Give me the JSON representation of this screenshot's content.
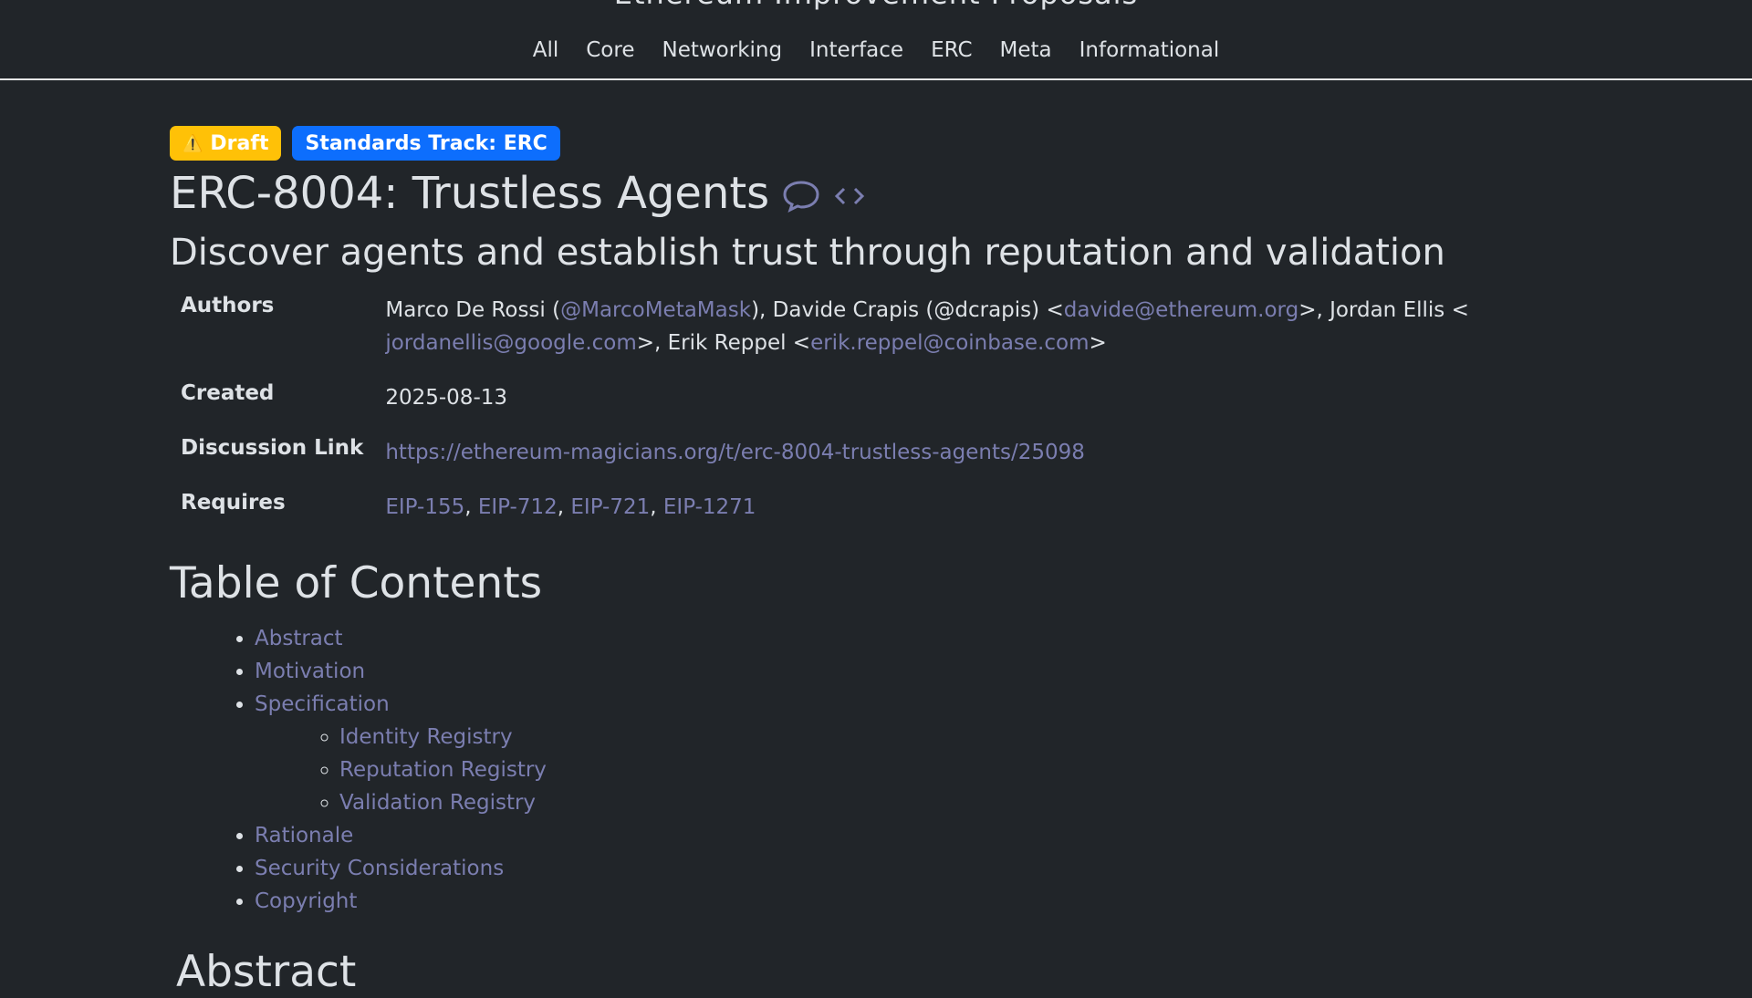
{
  "site": {
    "title": "Ethereum Improvement Proposals"
  },
  "nav": {
    "items": [
      {
        "label": "All"
      },
      {
        "label": "Core"
      },
      {
        "label": "Networking"
      },
      {
        "label": "Interface"
      },
      {
        "label": "ERC"
      },
      {
        "label": "Meta"
      },
      {
        "label": "Informational"
      }
    ]
  },
  "badges": {
    "draft_icon": "⚠️",
    "draft_label": "Draft",
    "track_label": "Standards Track: ERC",
    "draft_color": "#ffc107",
    "track_color": "#0d6efd"
  },
  "proposal": {
    "title": "ERC-8004: Trustless Agents",
    "subtitle": "Discover agents and establish trust through reputation and validation",
    "icons": [
      "comment-icon",
      "code-icon"
    ]
  },
  "meta": {
    "authors_label": "Authors",
    "authors": {
      "a1_text": "Marco De Rossi (",
      "a1_link": "@MarcoMetaMask",
      "a2_text": "), Davide Crapis (@dcrapis) <",
      "a2_link": "davide@ethereum.org",
      "a3_text": ">, Jordan Ellis <",
      "a3_link": "jordanellis@google.com",
      "a4_text": ">, Erik Reppel <",
      "a4_link": "erik.reppel@coinbase.com",
      "a4_end": ">"
    },
    "created_label": "Created",
    "created": "2025-08-13",
    "discussion_label": "Discussion Link",
    "discussion": "https://ethereum-magicians.org/t/erc-8004-trustless-agents/25098",
    "requires_label": "Requires",
    "requires": [
      "EIP-155",
      "EIP-712",
      "EIP-721",
      "EIP-1271"
    ]
  },
  "toc": {
    "heading": "Table of Contents",
    "items": [
      "Abstract",
      "Motivation",
      "Specification"
    ],
    "sub_items": [
      "Identity Registry",
      "Reputation Registry",
      "Validation Registry"
    ],
    "items_after": [
      "Rationale",
      "Security Considerations",
      "Copyright"
    ]
  },
  "sections": {
    "abstract_heading": "Abstract"
  },
  "colors": {
    "background": "#212529",
    "text": "#dee2e6",
    "link": "#7b7eb0"
  }
}
